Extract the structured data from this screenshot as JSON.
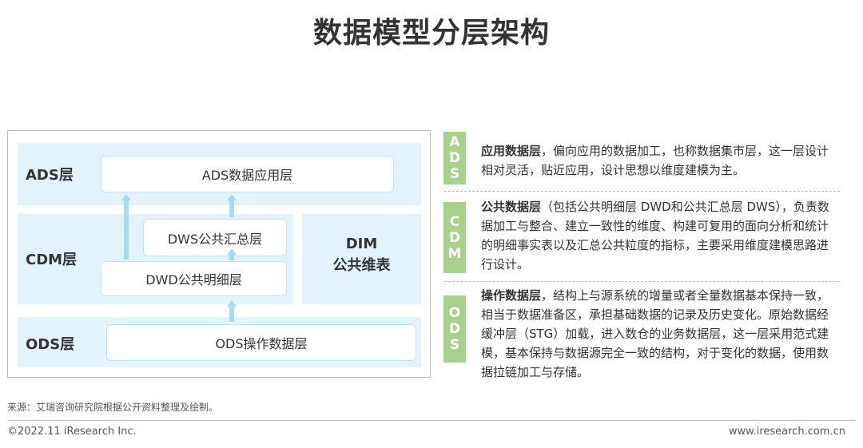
{
  "title": "数据模型分层架构",
  "diagram": {
    "layers": {
      "ads": "ADS层",
      "cdm": "CDM层",
      "ods": "ODS层"
    },
    "boxes": {
      "ads": "ADS数据应用层",
      "dws": "DWS公共汇总层",
      "dwd": "DWD公共明细层",
      "ods": "ODS操作数据层"
    },
    "dim": {
      "line1": "DIM",
      "line2": "公共维表"
    }
  },
  "descriptions": [
    {
      "tag": [
        "A",
        "D",
        "S"
      ],
      "bold": "应用数据层",
      "text": "，偏向应用的数据加工，也称数据集市层，这一层设计相对灵活，贴近应用，设计思想以维度建模为主。"
    },
    {
      "tag": [
        "C",
        "D",
        "M"
      ],
      "bold": "公共数据层",
      "text": "（包括公共明细层 DWD和公共汇总层 DWS），负责数据加工与整合、建立一致性的维度、构建可复用的面向分析和统计的明细事实表以及汇总公共粒度的指标，主要采用维度建模思路进行设计。"
    },
    {
      "tag": [
        "O",
        "D",
        "S"
      ],
      "bold": "操作数据层",
      "text": "，结构上与源系统的增量或者全量数据基本保持一致，相当于数据准备区，承担基础数据的记录及历史变化。原始数据经缓冲层（STG）加载，进入数仓的业务数据层，这一层采用范式建模，基本保持与数据源完全一致的结构，对于变化的数据，使用数据拉链加工与存储。"
    }
  ],
  "source": "来源：艾瑞咨询研究院根据公开资料整理及绘制。",
  "copyright": "©2022.11 iResearch Inc.",
  "website": "www.iresearch.com.cn",
  "colors": {
    "band": "#e4f3fb",
    "arrow": "#a4dcf5",
    "tag": "#a9d18e"
  }
}
